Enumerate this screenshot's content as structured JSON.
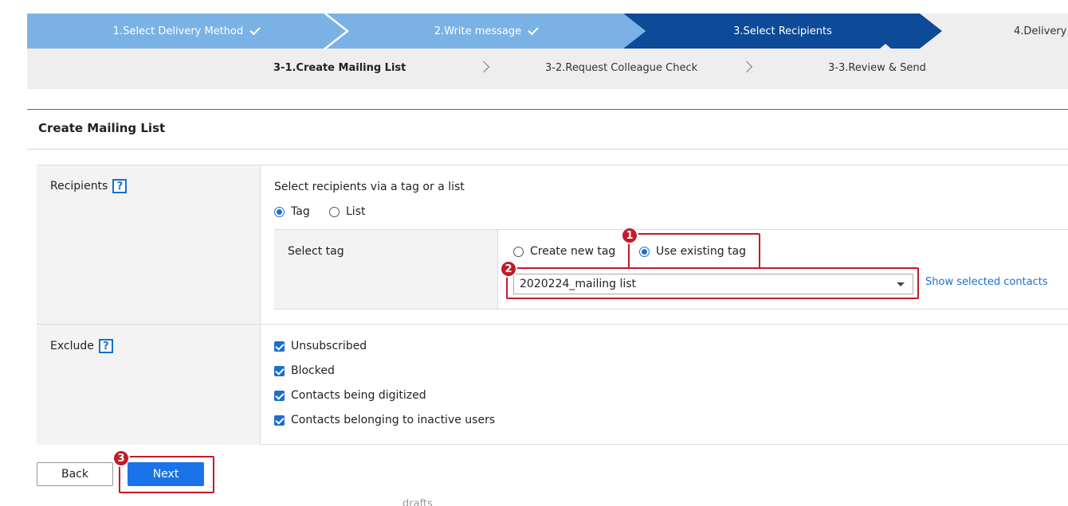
{
  "steps": [
    {
      "label": "1.Select Delivery Method",
      "done": true
    },
    {
      "label": "2.Write message",
      "done": true
    },
    {
      "label": "3.Select Recipients",
      "active": true
    },
    {
      "label": "4.Delivery"
    }
  ],
  "substeps": [
    {
      "label": "3-1.Create Mailing List",
      "active": true
    },
    {
      "label": "3-2.Request Colleague Check"
    },
    {
      "label": "3-3.Review & Send"
    }
  ],
  "section_title": "Create Mailing List",
  "recipients": {
    "label": "Recipients",
    "help": "?",
    "instruction": "Select recipients via a tag or a list",
    "options": [
      "Tag",
      "List"
    ],
    "selected": "Tag",
    "select_tag": {
      "label": "Select tag",
      "options": [
        "Create new tag",
        "Use existing tag"
      ],
      "selected": "Use existing tag",
      "dropdown_value": "2020224_mailing list",
      "show_contacts_link": "Show selected contacts"
    }
  },
  "exclude": {
    "label": "Exclude",
    "help": "?",
    "items": [
      {
        "label": "Unsubscribed",
        "checked": true
      },
      {
        "label": "Blocked",
        "checked": true
      },
      {
        "label": "Contacts being digitized",
        "checked": true
      },
      {
        "label": "Contacts belonging to inactive users",
        "checked": true
      }
    ]
  },
  "buttons": {
    "back": "Back",
    "next": "Next"
  },
  "callouts": [
    "1",
    "2",
    "3"
  ],
  "footer_text": "drafts",
  "colors": {
    "step_done": "#7bb2e6",
    "step_active": "#0d4a98",
    "accent": "#1a73e8",
    "callout": "#c41a2a"
  },
  "icons": [
    "checkmark-icon",
    "chevron-right-icon",
    "help-icon",
    "dropdown-caret-icon"
  ]
}
